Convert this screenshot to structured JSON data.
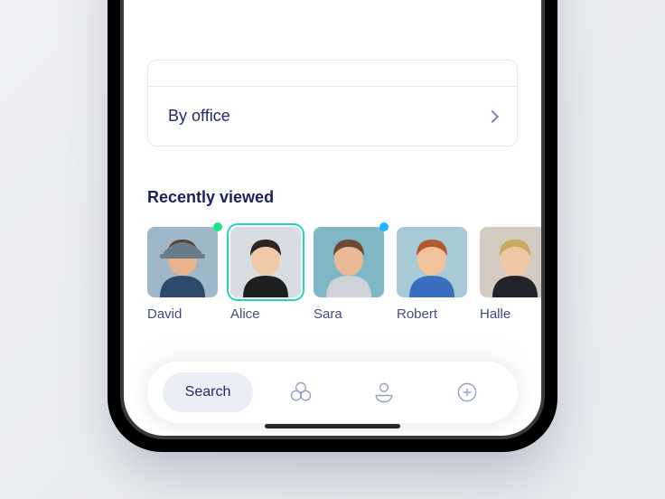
{
  "filters": {
    "by_office_label": "By office"
  },
  "section": {
    "recently_viewed_title": "Recently viewed"
  },
  "people": [
    {
      "name": "David",
      "status_color": "#1fe28a",
      "selected": false,
      "bg": "#9fb8c9",
      "skin": "#e7b48e",
      "hair": "#5a4634",
      "hat": "#6b7c89",
      "shirt": "#2c4a6b"
    },
    {
      "name": "Alice",
      "status_color": null,
      "selected": true,
      "bg": "#d7dde3",
      "skin": "#f1c9a6",
      "hair": "#2e2420",
      "hat": null,
      "shirt": "#1f1f1f"
    },
    {
      "name": "Sara",
      "status_color": "#18b7ff",
      "selected": false,
      "bg": "#7fb8c4",
      "skin": "#e9b995",
      "hair": "#6a4a34",
      "hat": null,
      "shirt": "#cfd2d6"
    },
    {
      "name": "Robert",
      "status_color": null,
      "selected": false,
      "bg": "#a8c9d6",
      "skin": "#f0c39a",
      "hair": "#b4562f",
      "hat": null,
      "shirt": "#3a6fbf"
    },
    {
      "name": "Halle",
      "status_color": null,
      "selected": false,
      "bg": "#d3cbbf",
      "skin": "#efc7a3",
      "hair": "#c9a861",
      "hat": null,
      "shirt": "#20242a"
    }
  ],
  "tabs": {
    "search_label": "Search"
  }
}
